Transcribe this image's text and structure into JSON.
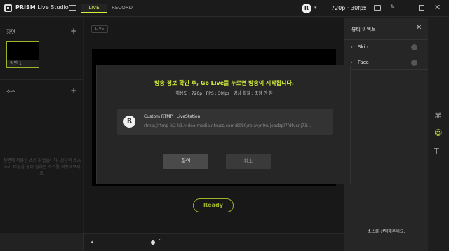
{
  "app": {
    "brand": "PRISM",
    "name": "Live Studio"
  },
  "topbar": {
    "tab_live": "LIVE",
    "tab_record": "RECORD",
    "avatar_letter": "R",
    "resolution": "720p · 30fps"
  },
  "left_panel": {
    "scenes_title": "장면",
    "scene_items": [
      {
        "label": "장면 1"
      }
    ],
    "sources_title": "소스",
    "empty_sources_text": "장면에 적용된 소스가 없습니다. 상단의 소스 추가 버튼을 눌러 원하는 소스를 적용해보세요."
  },
  "center": {
    "live_badge": "LIVE",
    "ready_label": "Ready"
  },
  "right_panel": {
    "title": "뷰티 이펙트",
    "items": [
      {
        "label": "Skin"
      },
      {
        "label": "Face"
      }
    ],
    "footer": "소스를 선택해주세요."
  },
  "dialog": {
    "title": "방송 정보 확인 후, Go Live를 누르면 방송이 시작됩니다.",
    "subtitle": "해상도 : 720p · FPS : 30fps · 영상 화질 : 조정 안 함",
    "account": {
      "icon_letter": "R",
      "name": "Custom RTMP · LiveStation",
      "url": "rtmp://rtmp-ls2-k1.video.media.ntruss.com:8080/relay/n9rujoodzpl7fdtvsnj73..."
    },
    "confirm_label": "확인",
    "cancel_label": "취소"
  },
  "colors": {
    "accent": "#d6ee3a",
    "background": "#1e1e1e",
    "panel": "#222222",
    "dialog": "#262626"
  },
  "icons": [
    "menu-icon",
    "chat-icon",
    "pin-icon",
    "plus-icon",
    "close-icon",
    "volume-icon",
    "chevron-right-icon",
    "layers-icon",
    "smile-icon",
    "text-icon"
  ]
}
